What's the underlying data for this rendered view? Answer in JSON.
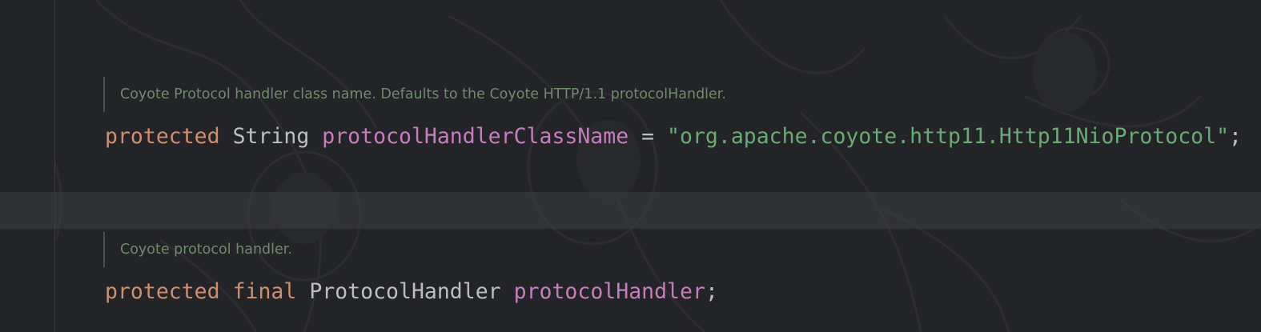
{
  "editor": {
    "blocks": [
      {
        "doc_comment": "Coyote Protocol handler class name. Defaults to the Coyote HTTP/1.1 protocolHandler.",
        "tokens": {
          "modifier": "protected",
          "type": "String",
          "name": "protocolHandlerClassName",
          "assign": " = ",
          "value": "\"org.apache.coyote.http11.Http11NioProtocol\"",
          "semicolon": ";"
        }
      },
      {
        "doc_comment": "Coyote protocol handler.",
        "tokens": {
          "modifier": "protected",
          "modifier2": "final",
          "type": "ProtocolHandler",
          "name": "protocolHandler",
          "semicolon": ";"
        }
      }
    ]
  },
  "colors": {
    "background": "#232427",
    "keyword": "#cf8e6d",
    "field": "#c77dbb",
    "string": "#6aab73",
    "doc_comment": "#6f8a6d",
    "text": "#bcbec4"
  }
}
